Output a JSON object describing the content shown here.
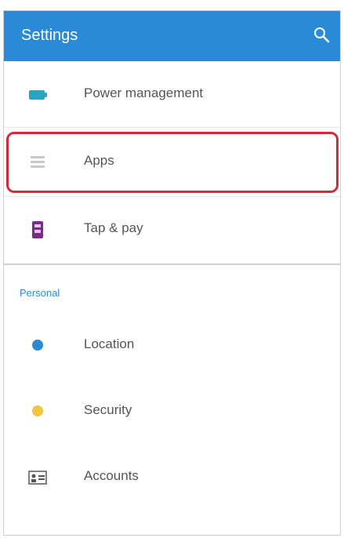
{
  "appbar": {
    "title": "Settings",
    "search_icon": "search-icon",
    "color": "#2a8ad8"
  },
  "sections": [
    {
      "items": [
        {
          "label": "Power management",
          "icon": "battery-icon"
        },
        {
          "label": "Apps",
          "icon": "apps-icon",
          "highlighted": true
        },
        {
          "label": "Tap & pay",
          "icon": "tap-pay-icon"
        }
      ]
    },
    {
      "header": "Personal",
      "items": [
        {
          "label": "Location",
          "icon": "location-icon"
        },
        {
          "label": "Security",
          "icon": "security-icon"
        },
        {
          "label": "Accounts",
          "icon": "accounts-icon"
        }
      ]
    }
  ],
  "highlight_color": "#d42a3b"
}
